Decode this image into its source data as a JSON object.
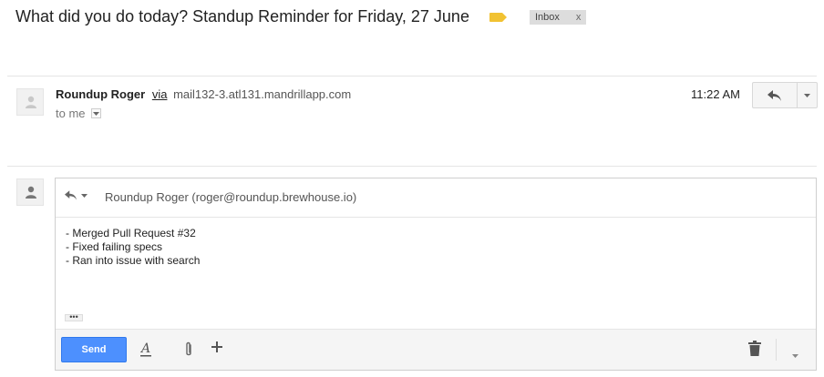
{
  "thread": {
    "subject": "What did you do today? Standup Reminder for Friday, 27 June",
    "label_chip": "Inbox",
    "label_chip_close": "x"
  },
  "message": {
    "sender_name": "Roundup Roger",
    "via_label": "via",
    "via_host": "mail132-3.atl131.mandrillapp.com",
    "to_label": "to me",
    "time": "11:22 AM"
  },
  "reply": {
    "recipient": "Roundup Roger (roger@roundup.brewhouse.io)",
    "body_lines": [
      "- Merged Pull Request #32",
      "- Fixed failing specs",
      "- Ran into issue with search"
    ],
    "quoted_toggle": "•••",
    "send_label": "Send"
  },
  "colors": {
    "send_button": "#4d90fe",
    "label_tag": "#f1c232",
    "chip_background": "#dddddd"
  },
  "icons": [
    "label-tag-icon",
    "person-icon",
    "reply-icon",
    "dropdown-arrow-icon",
    "text-format-icon",
    "attach-icon",
    "plus-icon",
    "trash-icon"
  ]
}
